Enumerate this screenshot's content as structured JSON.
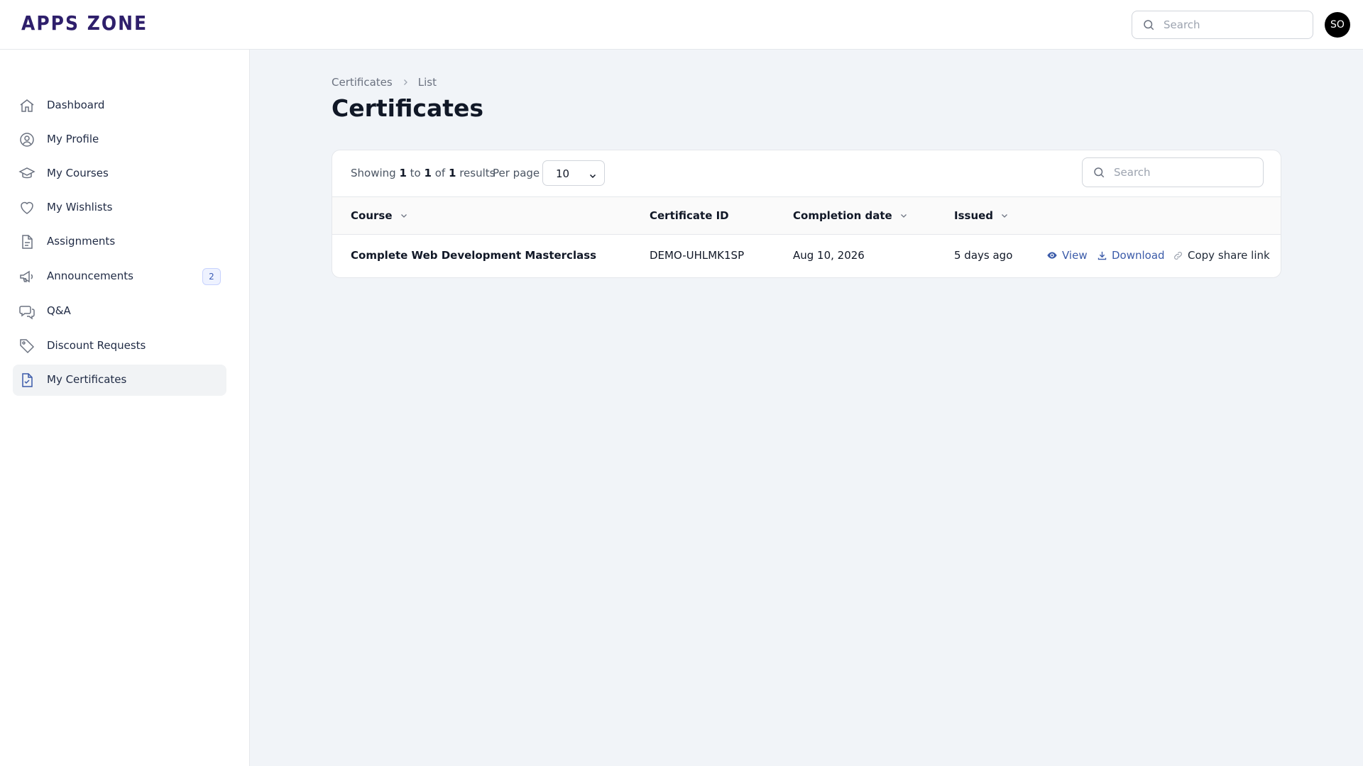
{
  "app": {
    "logo": "APPS ZONE"
  },
  "header": {
    "search_placeholder": "Search",
    "avatar_initials": "SO"
  },
  "sidebar": {
    "items": [
      {
        "label": "Dashboard",
        "icon": "home-icon"
      },
      {
        "label": "My Profile",
        "icon": "user-circle-icon"
      },
      {
        "label": "My Courses",
        "icon": "graduation-cap-icon"
      },
      {
        "label": "My Wishlists",
        "icon": "heart-icon"
      },
      {
        "label": "Assignments",
        "icon": "document-icon"
      },
      {
        "label": "Announcements",
        "icon": "megaphone-icon",
        "badge": "2"
      },
      {
        "label": "Q&A",
        "icon": "chat-bubbles-icon"
      },
      {
        "label": "Discount Requests",
        "icon": "tag-icon"
      },
      {
        "label": "My Certificates",
        "icon": "document-check-icon",
        "active": true
      }
    ]
  },
  "breadcrumb": {
    "parent": "Certificates",
    "current": "List"
  },
  "page": {
    "title": "Certificates"
  },
  "table": {
    "summary": {
      "prefix": "Showing",
      "from": "1",
      "to_word": "to",
      "to": "1",
      "of_word": "of",
      "total": "1",
      "suffix": "results"
    },
    "per_page_label": "Per page",
    "per_page_value": "10",
    "search_placeholder": "Search",
    "columns": {
      "course": "Course",
      "certificate_id": "Certificate ID",
      "completion_date": "Completion date",
      "issued": "Issued"
    },
    "rows": [
      {
        "course": "Complete Web Development Masterclass",
        "certificate_id": "DEMO-UHLMK1SP",
        "completion_date": "Aug 10, 2026",
        "issued": "5 days ago",
        "actions": {
          "view": "View",
          "download": "Download",
          "copy": "Copy share link"
        }
      }
    ]
  },
  "colors": {
    "accent": "#3b5ba9",
    "brand": "#2e1f6b",
    "background": "#f1f4f8"
  }
}
